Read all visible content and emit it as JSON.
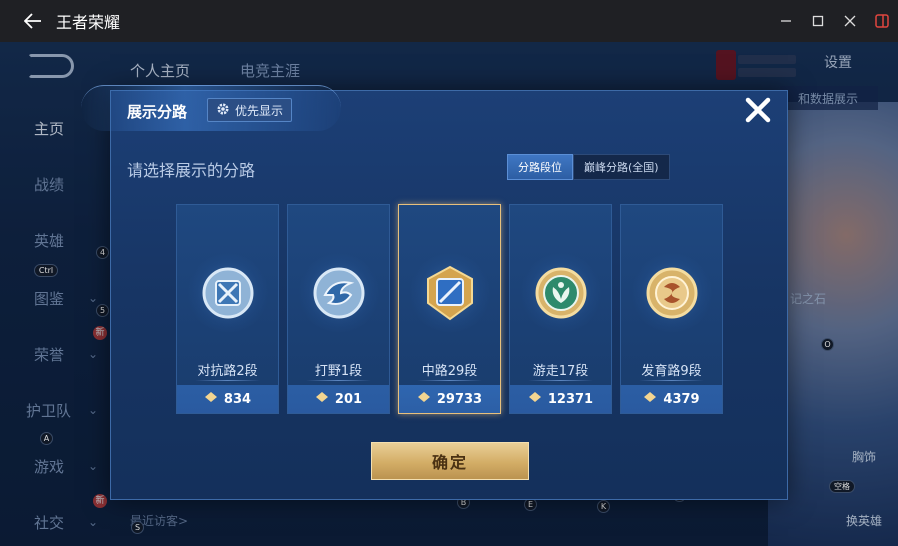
{
  "window": {
    "title": "王者荣耀"
  },
  "nav": {
    "tabs": [
      "个人主页",
      "电竞主涯"
    ],
    "settings_label": "设置",
    "bg_strip": "和数据展示",
    "bg_strip2": "记之石"
  },
  "sidebar": {
    "items": [
      "主页",
      "战绩",
      "英雄",
      "图鉴",
      "荣誉",
      "护卫队",
      "游戏",
      "社交"
    ],
    "badge": "新"
  },
  "visitor_label": "最近访客>",
  "hotkeys": [
    "Ctrl",
    "4",
    "5",
    "W",
    "A",
    "D",
    "G",
    "3",
    "2",
    "O",
    "I",
    "1",
    "B",
    "E",
    "K",
    "J",
    "S",
    "空格"
  ],
  "bottom_right": {
    "label1": "胸饰",
    "label2": "换英雄"
  },
  "modal": {
    "title": "展示分路",
    "priority_label": "优先显示",
    "subtitle": "请选择展示的分路",
    "segments": [
      {
        "label": "分路段位",
        "active": true
      },
      {
        "label": "巅峰分路(全国)",
        "active": false
      }
    ],
    "cards": [
      {
        "rank": "对抗路2段",
        "score": "834",
        "icon": "top-lane-emblem-icon",
        "selected": false
      },
      {
        "rank": "打野1段",
        "score": "201",
        "icon": "jungle-emblem-icon",
        "selected": false
      },
      {
        "rank": "中路29段",
        "score": "29733",
        "icon": "mid-lane-emblem-icon",
        "selected": true
      },
      {
        "rank": "游走17段",
        "score": "12371",
        "icon": "roam-emblem-icon",
        "selected": false
      },
      {
        "rank": "发育路9段",
        "score": "4379",
        "icon": "farm-lane-emblem-icon",
        "selected": false
      }
    ],
    "confirm_label": "确定"
  },
  "colors": {
    "accent_gold": "#e7c07d",
    "modal_bg": "#1c3f76",
    "close_red": "#e0463e"
  }
}
